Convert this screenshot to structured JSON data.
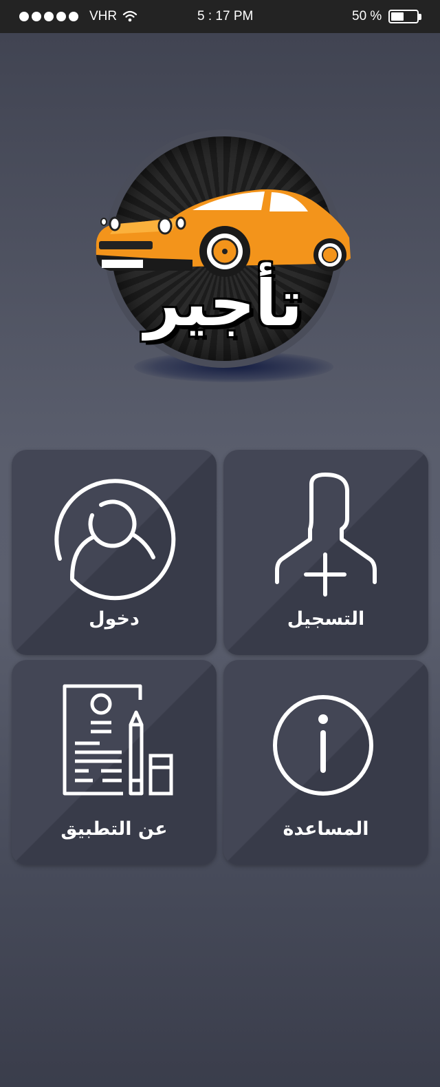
{
  "status_bar": {
    "carrier": "VHR",
    "time": "5 : 17 PM",
    "battery": "50 %",
    "battery_level": 0.5,
    "signal_bars": 5
  },
  "logo": {
    "text": "تأجير",
    "car_color": "#f3941b"
  },
  "menu": {
    "login": {
      "label": "دخول",
      "icon": "user-circle-icon"
    },
    "register": {
      "label": "التسجيل",
      "icon": "add-user-icon"
    },
    "about": {
      "label": "عن التطبيق",
      "icon": "document-pencil-icon"
    },
    "help": {
      "label": "المساعدة",
      "icon": "info-icon"
    }
  }
}
